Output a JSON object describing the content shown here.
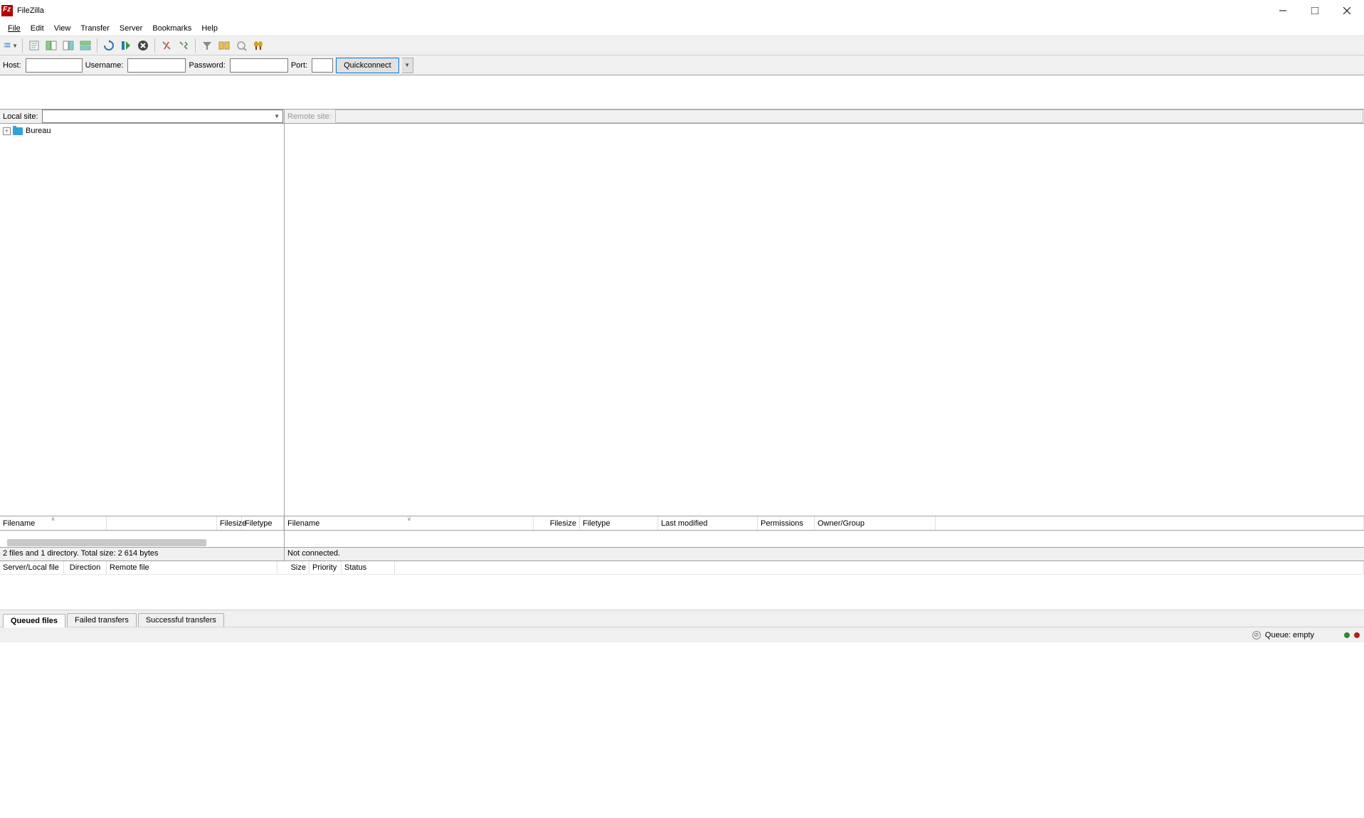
{
  "title": "FileZilla",
  "menu": {
    "file": "File",
    "edit": "Edit",
    "view": "View",
    "transfer": "Transfer",
    "server": "Server",
    "bookmarks": "Bookmarks",
    "help": "Help"
  },
  "quickconnect": {
    "host_label": "Host:",
    "username_label": "Username:",
    "password_label": "Password:",
    "port_label": "Port:",
    "button": "Quickconnect",
    "host_value": "",
    "username_value": "",
    "password_value": "",
    "port_value": ""
  },
  "sites": {
    "local_label": "Local site:",
    "remote_label": "Remote site:",
    "local_value": "",
    "remote_value": ""
  },
  "local_tree": {
    "root": "Bureau"
  },
  "local_list": {
    "cols": {
      "filename": "Filename",
      "filesize": "Filesize",
      "filetype": "Filetype"
    },
    "status": "2 files and 1 directory. Total size: 2 614 bytes"
  },
  "remote_list": {
    "cols": {
      "filename": "Filename",
      "filesize": "Filesize",
      "filetype": "Filetype",
      "last_modified": "Last modified",
      "permissions": "Permissions",
      "owner_group": "Owner/Group"
    },
    "status": "Not connected."
  },
  "queue": {
    "cols": {
      "server_local": "Server/Local file",
      "direction": "Direction",
      "remote_file": "Remote file",
      "size": "Size",
      "priority": "Priority",
      "status": "Status"
    }
  },
  "tabs": {
    "queued": "Queued files",
    "failed": "Failed transfers",
    "successful": "Successful transfers"
  },
  "statusbar": {
    "queue": "Queue: empty"
  }
}
